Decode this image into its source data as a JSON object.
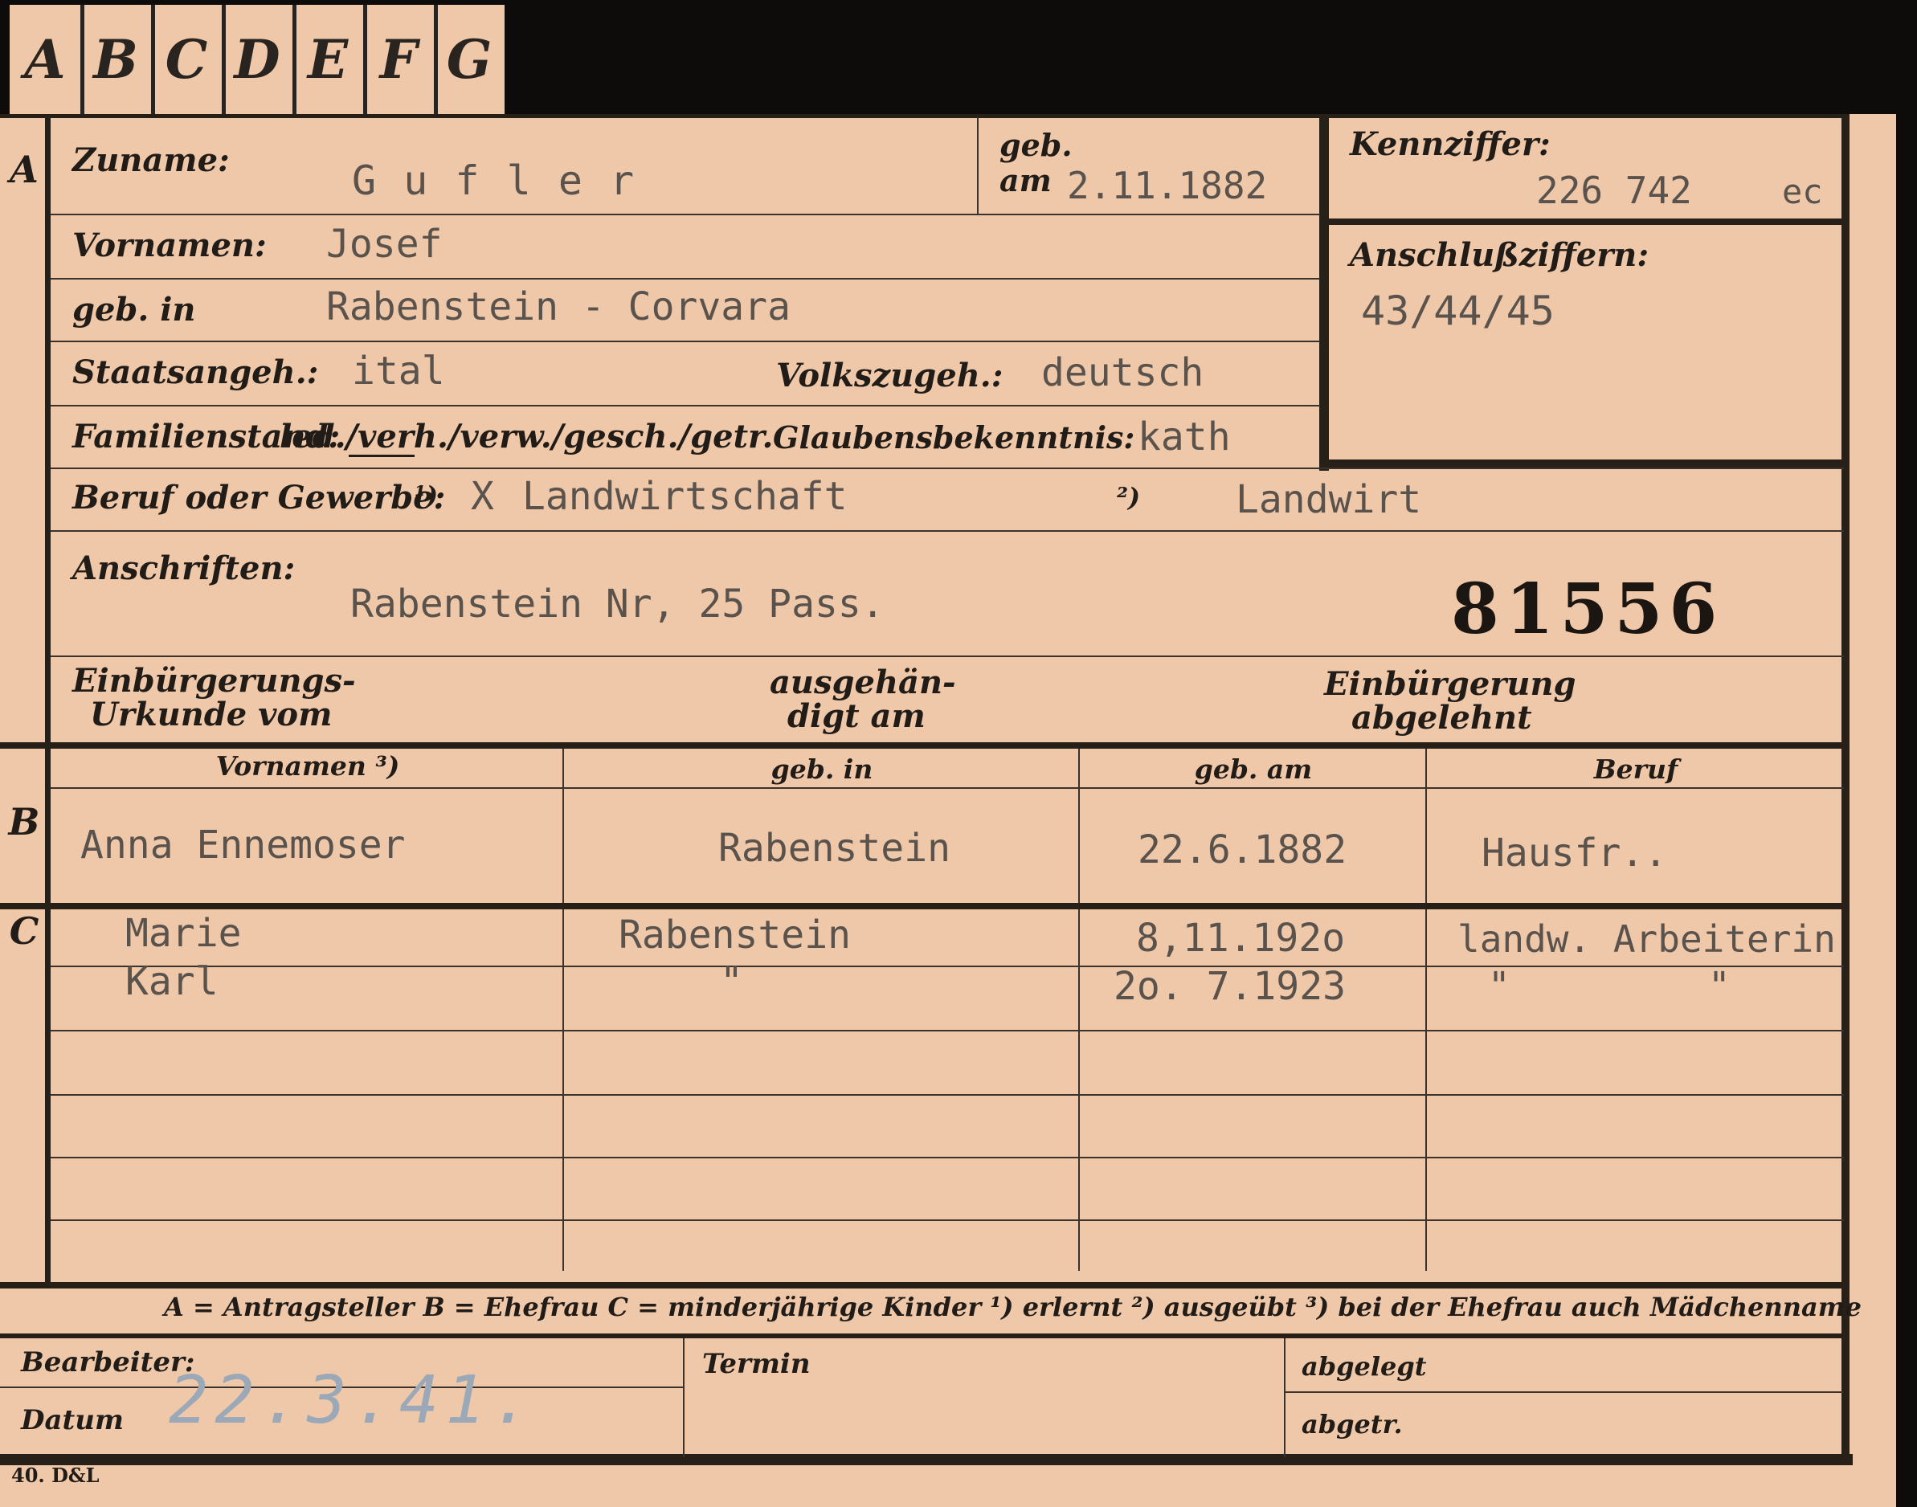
{
  "tabs": [
    "A",
    "B",
    "C",
    "D",
    "E",
    "F",
    "G"
  ],
  "sections": {
    "a": "A",
    "b": "B",
    "c": "C"
  },
  "labels": {
    "zuname": "Zuname:",
    "geb": "geb.",
    "am": "am",
    "kennziffer": "Kennziffer:",
    "vornamen": "Vornamen:",
    "anschlussziffern": "Anschlußziffern:",
    "geb_in": "geb. in",
    "staatsangeh": "Staatsangeh.:",
    "volkszugeh": "Volkszugeh.:",
    "familienstand": "Familienstand:",
    "familienstand_options": "led./verh./verw./gesch./getr.",
    "glaubensbekenntnis": "Glaubensbekenntnis:",
    "beruf_oder_gewerbe": "Beruf oder Gewerbe:",
    "note1": "¹)",
    "note2": "²)",
    "anschriften": "Anschriften:",
    "einbuergerungs_urkunde_1": "Einbürgerungs-",
    "einbuergerungs_urkunde_2": "Urkunde vom",
    "ausgehaendigt_1": "ausgehän-",
    "ausgehaendigt_2": "digt am",
    "einbuergerung_abgelehnt_1": "Einbürgerung",
    "einbuergerung_abgelehnt_2": "abgelehnt",
    "bearbeiter": "Bearbeiter:",
    "datum": "Datum",
    "termin": "Termin",
    "abgelegt": "abgelegt",
    "abgetr": "abgetr.",
    "printer_mark": "40. D&L"
  },
  "person": {
    "zuname": "G u f l e r",
    "geb_am": "2.11.1882",
    "kennziffer": "226 742",
    "kennziffer_suffix": "ec",
    "vornamen": "Josef",
    "anschlussziffern": "43/44/45",
    "geb_in": "Rabenstein - Corvara",
    "staatsangeh": "ital",
    "volkszugeh": "deutsch",
    "glaubensbekenntnis": "kath",
    "beruf_erlernt": "Landwirtschaft",
    "beruf_ausgeuebt": "Landwirt",
    "anschrift": "Rabenstein Nr, 25 Pass.",
    "card_number": "81556"
  },
  "table": {
    "headers": [
      "Vornamen ³)",
      "geb. in",
      "geb. am",
      "Beruf"
    ],
    "ehefrau": {
      "vornamen": "Anna Ennemoser",
      "geb_in": "Rabenstein",
      "geb_am": "22.6.1882",
      "beruf": "Hausfr.."
    },
    "kinder": [
      {
        "vornamen": "Marie",
        "geb_in": "Rabenstein",
        "geb_am": "8,11.192o",
        "beruf": "landw. Arbeiterin",
        "beruf_2": ""
      },
      {
        "vornamen": "Karl",
        "geb_in": "\"",
        "geb_am": "2o. 7.1923",
        "beruf": "\"",
        "beruf_2": "\""
      }
    ]
  },
  "legend": "A = Antragsteller   B = Ehefrau   C = minderjährige Kinder   ¹) erlernt   ²) ausgeübt   ³) bei der Ehefrau auch Mädchenname",
  "footer": {
    "datum_value": "22.3.41."
  }
}
